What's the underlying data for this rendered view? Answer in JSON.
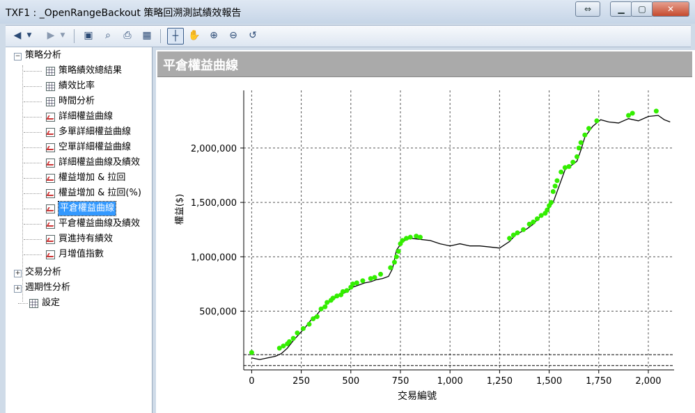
{
  "window": {
    "title": "TXF1 : _OpenRangeBackout 策略回溯測試績效報告"
  },
  "toolbar": {
    "buttons": [
      "back-icon",
      "forward-icon",
      "save-icon",
      "preview-icon",
      "print-icon",
      "table-icon",
      "crosshair-icon",
      "hand-icon",
      "zoom-in-icon",
      "zoom-out-icon",
      "reset-icon"
    ]
  },
  "tree": {
    "root1": "策略分析",
    "items": [
      "策略績效總結果",
      "績效比率",
      "時間分析",
      "詳細權益曲線",
      "多單詳細權益曲線",
      "空單詳細權益曲線",
      "詳細權益曲線及績效",
      "權益增加 & 拉回",
      "權益增加 & 拉回(%)",
      "平倉權益曲線",
      "平倉權益曲線及績效",
      "買進持有績效",
      "月增值指數"
    ],
    "root2": "交易分析",
    "root3": "週期性分析",
    "root4": "設定"
  },
  "panel": {
    "title": "平倉權益曲線"
  },
  "chart_data": {
    "type": "line",
    "xlabel": "交易編號",
    "ylabel": "權益($)",
    "xlim": [
      -40,
      2130
    ],
    "ylim": [
      -40000,
      2530000
    ],
    "xticks": [
      "0",
      "250",
      "500",
      "750",
      "1,000",
      "1,250",
      "1,500",
      "1,750",
      "2,000"
    ],
    "xtick_values": [
      0,
      250,
      500,
      750,
      1000,
      1250,
      1500,
      1750,
      2000
    ],
    "yticks": [
      "500,000",
      "1,000,000",
      "1,500,000",
      "2,000,000"
    ],
    "ytick_values": [
      500000,
      1000000,
      1500000,
      2000000
    ],
    "hlines": [
      0,
      100000
    ],
    "grid": true,
    "series": [
      {
        "color": "#000000",
        "x": [
          0,
          40,
          80,
          120,
          150,
          180,
          210,
          240,
          270,
          300,
          330,
          360,
          390,
          420,
          450,
          480,
          510,
          540,
          570,
          600,
          630,
          660,
          690,
          710,
          730,
          760,
          800,
          850,
          900,
          950,
          1000,
          1050,
          1100,
          1150,
          1200,
          1250,
          1300,
          1330,
          1360,
          1390,
          1420,
          1450,
          1480,
          1500,
          1520,
          1540,
          1560,
          1580,
          1600,
          1620,
          1640,
          1660,
          1680,
          1700,
          1720,
          1740,
          1760,
          1800,
          1850,
          1900,
          1950,
          2000,
          2050,
          2080,
          2110
        ],
        "y": [
          70000,
          55000,
          70000,
          85000,
          110000,
          160000,
          230000,
          290000,
          350000,
          420000,
          470000,
          540000,
          580000,
          620000,
          650000,
          680000,
          720000,
          740000,
          760000,
          770000,
          790000,
          800000,
          820000,
          890000,
          1060000,
          1140000,
          1170000,
          1160000,
          1150000,
          1120000,
          1100000,
          1120000,
          1100000,
          1100000,
          1090000,
          1080000,
          1140000,
          1200000,
          1230000,
          1260000,
          1300000,
          1360000,
          1400000,
          1450000,
          1500000,
          1600000,
          1700000,
          1800000,
          1830000,
          1850000,
          1880000,
          1980000,
          2100000,
          2150000,
          2200000,
          2230000,
          2260000,
          2240000,
          2230000,
          2270000,
          2250000,
          2290000,
          2300000,
          2260000,
          2240000
        ]
      },
      {
        "color": "#33ee00",
        "points": true,
        "x": [
          0,
          140,
          160,
          180,
          190,
          210,
          230,
          260,
          290,
          310,
          330,
          350,
          370,
          380,
          400,
          410,
          430,
          450,
          460,
          480,
          500,
          510,
          530,
          560,
          600,
          620,
          650,
          700,
          720,
          730,
          740,
          750,
          760,
          780,
          800,
          830,
          850,
          1300,
          1320,
          1340,
          1370,
          1400,
          1420,
          1440,
          1460,
          1480,
          1490,
          1500,
          1510,
          1520,
          1530,
          1540,
          1560,
          1580,
          1600,
          1620,
          1640,
          1650,
          1660,
          1680,
          1700,
          1740,
          1900,
          1920,
          2040
        ],
        "y": [
          120000,
          160000,
          180000,
          200000,
          220000,
          250000,
          300000,
          340000,
          380000,
          430000,
          450000,
          520000,
          540000,
          580000,
          600000,
          620000,
          640000,
          650000,
          680000,
          690000,
          720000,
          750000,
          760000,
          780000,
          800000,
          810000,
          840000,
          900000,
          950000,
          1000000,
          1050000,
          1120000,
          1150000,
          1170000,
          1180000,
          1190000,
          1180000,
          1170000,
          1200000,
          1220000,
          1250000,
          1300000,
          1320000,
          1350000,
          1380000,
          1400000,
          1430000,
          1470000,
          1500000,
          1600000,
          1650000,
          1700000,
          1780000,
          1820000,
          1830000,
          1870000,
          1920000,
          2000000,
          2050000,
          2120000,
          2180000,
          2250000,
          2300000,
          2320000,
          2340000
        ]
      }
    ]
  }
}
